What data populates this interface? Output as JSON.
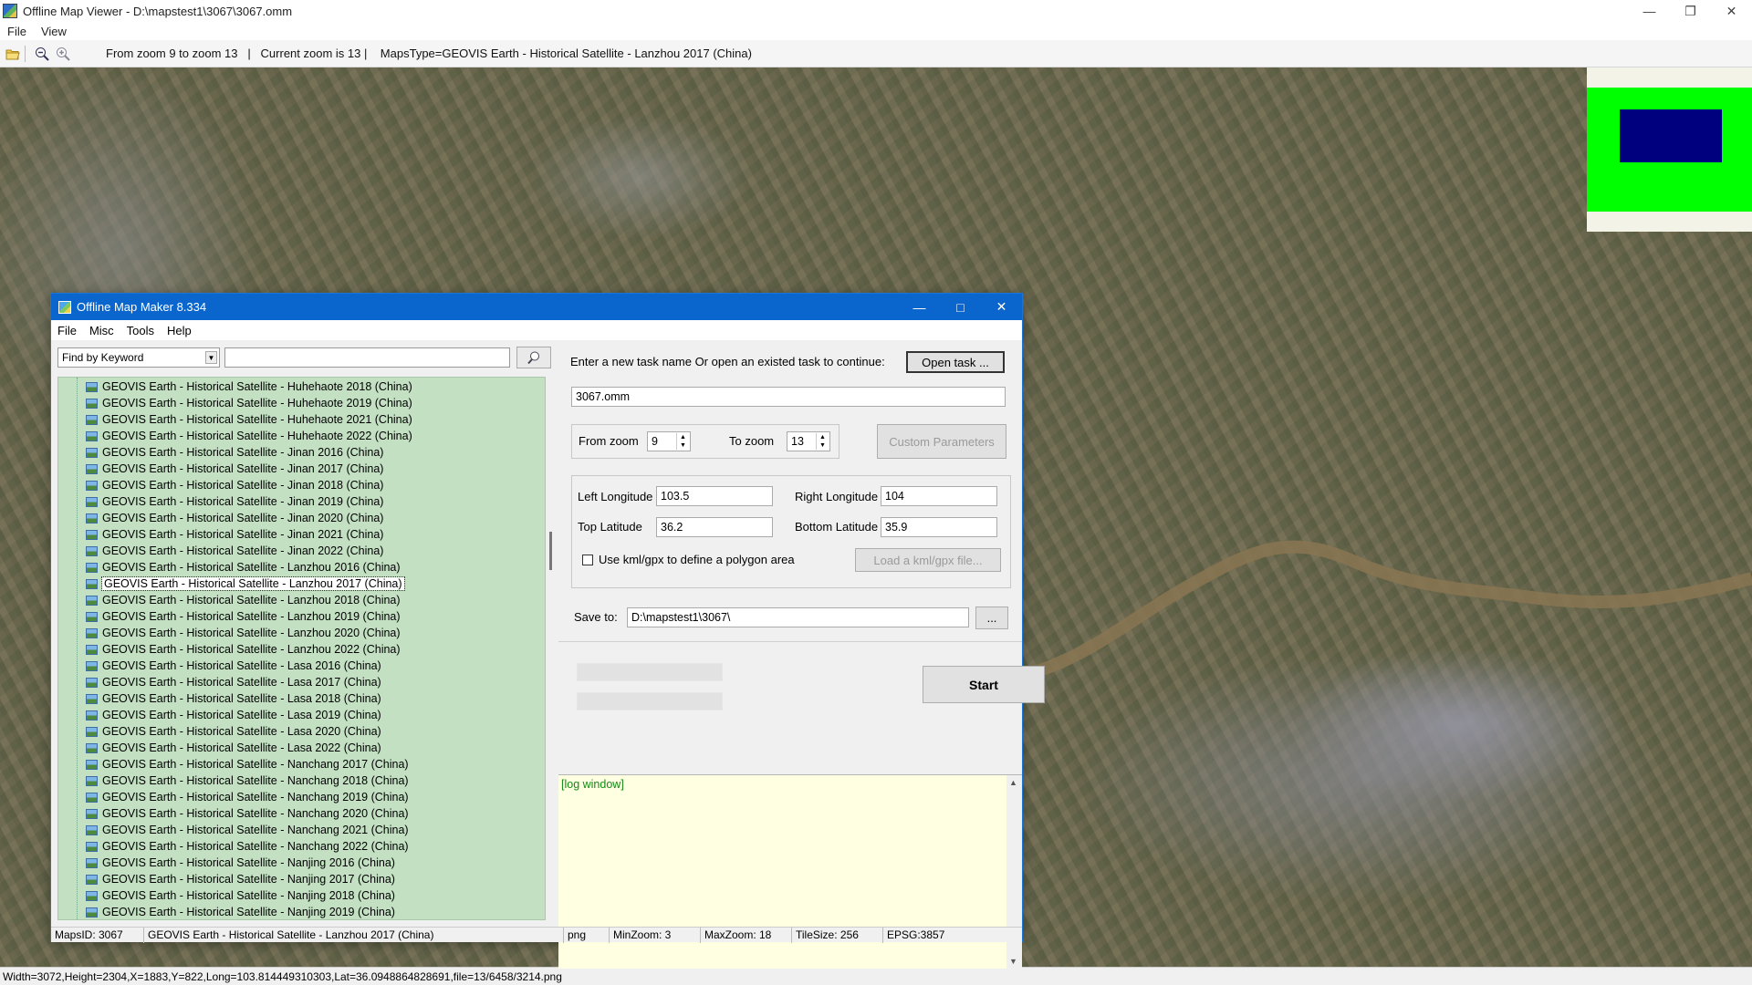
{
  "viewer": {
    "title": "Offline Map Viewer - D:\\mapstest1\\3067\\3067.omm",
    "menu": [
      "File",
      "View"
    ],
    "toolbar_status": "From zoom 9 to zoom 13   |   Current zoom is 13 |    MapsType=GEOVIS Earth - Historical Satellite - Lanzhou 2017 (China)",
    "status_bar": "Width=3072,Height=2304,X=1883,Y=822,Long=103.814449310303,Lat=36.0948864828691,file=13/6458/3214.png",
    "icons": [
      "open-folder-icon",
      "zoom-out-icon",
      "zoom-in-icon"
    ],
    "colors": {
      "overview_frame": "#00ff00",
      "overview_view": "#00007f"
    }
  },
  "maker": {
    "title": "Offline Map Maker 8.334",
    "menu": [
      "File",
      "Misc",
      "Tools",
      "Help"
    ],
    "find": {
      "mode": "Find by Keyword",
      "keyword": ""
    },
    "tree_items": [
      "GEOVIS Earth - Historical Satellite - Huhehaote 2018 (China)",
      "GEOVIS Earth - Historical Satellite - Huhehaote 2019 (China)",
      "GEOVIS Earth - Historical Satellite - Huhehaote 2021 (China)",
      "GEOVIS Earth - Historical Satellite - Huhehaote 2022 (China)",
      "GEOVIS Earth - Historical Satellite - Jinan 2016 (China)",
      "GEOVIS Earth - Historical Satellite - Jinan 2017 (China)",
      "GEOVIS Earth - Historical Satellite - Jinan 2018 (China)",
      "GEOVIS Earth - Historical Satellite - Jinan 2019 (China)",
      "GEOVIS Earth - Historical Satellite - Jinan 2020 (China)",
      "GEOVIS Earth - Historical Satellite - Jinan 2021 (China)",
      "GEOVIS Earth - Historical Satellite - Jinan 2022 (China)",
      "GEOVIS Earth - Historical Satellite - Lanzhou 2016 (China)",
      "GEOVIS Earth - Historical Satellite - Lanzhou 2017 (China)",
      "GEOVIS Earth - Historical Satellite - Lanzhou 2018 (China)",
      "GEOVIS Earth - Historical Satellite - Lanzhou 2019 (China)",
      "GEOVIS Earth - Historical Satellite - Lanzhou 2020 (China)",
      "GEOVIS Earth - Historical Satellite - Lanzhou 2022 (China)",
      "GEOVIS Earth - Historical Satellite - Lasa 2016 (China)",
      "GEOVIS Earth - Historical Satellite - Lasa 2017 (China)",
      "GEOVIS Earth - Historical Satellite - Lasa 2018 (China)",
      "GEOVIS Earth - Historical Satellite - Lasa 2019 (China)",
      "GEOVIS Earth - Historical Satellite - Lasa 2020 (China)",
      "GEOVIS Earth - Historical Satellite - Lasa 2022 (China)",
      "GEOVIS Earth - Historical Satellite - Nanchang 2017 (China)",
      "GEOVIS Earth - Historical Satellite - Nanchang 2018 (China)",
      "GEOVIS Earth - Historical Satellite - Nanchang 2019 (China)",
      "GEOVIS Earth - Historical Satellite - Nanchang 2020 (China)",
      "GEOVIS Earth - Historical Satellite - Nanchang 2021 (China)",
      "GEOVIS Earth - Historical Satellite - Nanchang 2022 (China)",
      "GEOVIS Earth - Historical Satellite - Nanjing 2016 (China)",
      "GEOVIS Earth - Historical Satellite - Nanjing 2017 (China)",
      "GEOVIS Earth - Historical Satellite - Nanjing 2018 (China)",
      "GEOVIS Earth - Historical Satellite - Nanjing 2019 (China)"
    ],
    "selected_item": "GEOVIS Earth - Historical Satellite - Lanzhou 2017 (China)",
    "task": {
      "prompt": "Enter a new task name Or open an existed task to continue:",
      "open_btn": "Open task ...",
      "name": "3067.omm"
    },
    "zoom": {
      "from_label": "From zoom",
      "from_value": "9",
      "to_label": "To zoom",
      "to_value": "13",
      "custom_btn": "Custom Parameters"
    },
    "bounds": {
      "left_lon_label": "Left Longitude",
      "left_lon": "103.5",
      "right_lon_label": "Right Longitude",
      "right_lon": "104",
      "top_lat_label": "Top Latitude",
      "top_lat": "36.2",
      "bottom_lat_label": "Bottom Latitude",
      "bottom_lat": "35.9",
      "kml_label": "Use kml/gpx to define a polygon area",
      "kml_checked": false,
      "load_kml_btn": "Load a kml/gpx file..."
    },
    "save": {
      "label": "Save to:",
      "path": "D:\\mapstest1\\3067\\",
      "browse_btn": "..."
    },
    "start_btn": "Start",
    "log_text": "[log window]",
    "status": {
      "maps_id": "MapsID: 3067",
      "maps_name": "GEOVIS Earth - Historical Satellite - Lanzhou 2017 (China)",
      "format": "png",
      "min_zoom": "MinZoom: 3",
      "max_zoom": "MaxZoom: 18",
      "tile_size": "TileSize: 256",
      "epsg": "EPSG:3857"
    }
  }
}
